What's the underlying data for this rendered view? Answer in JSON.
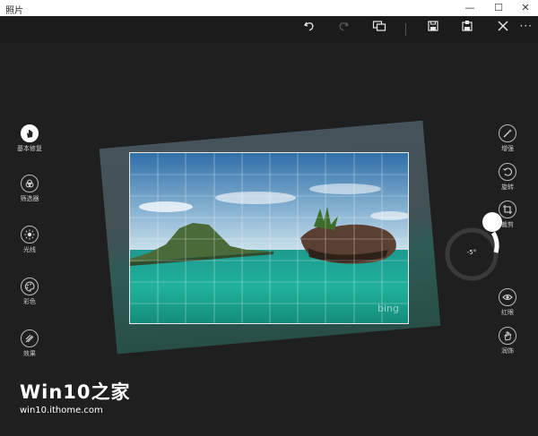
{
  "window": {
    "title": "照片",
    "minimize": "—",
    "maximize": "☐",
    "close": "✕"
  },
  "toolbar": {
    "undo_icon": "undo-icon",
    "redo_icon": "redo-icon",
    "compare_icon": "compare-icon",
    "save_icon": "save-icon",
    "save_copy_icon": "save-copy-icon",
    "cancel_icon": "close-icon",
    "more": "···"
  },
  "left_tools": [
    {
      "label": "基本修复",
      "icon": "hand-icon"
    },
    {
      "label": "筛选器",
      "icon": "filter-icon"
    },
    {
      "label": "光线",
      "icon": "sun-icon"
    },
    {
      "label": "彩色",
      "icon": "palette-icon"
    },
    {
      "label": "效果",
      "icon": "effects-icon"
    }
  ],
  "right_tools": [
    {
      "label": "增强",
      "icon": "wand-icon"
    },
    {
      "label": "旋转",
      "icon": "rotate-icon"
    },
    {
      "label": "裁剪",
      "icon": "crop-icon"
    },
    {
      "label": "红眼",
      "icon": "eye-icon"
    },
    {
      "label": "润饰",
      "icon": "hand-icon"
    }
  ],
  "photo": {
    "watermark": "bing"
  },
  "rotation": {
    "value_label": "-5°",
    "angle": -5
  },
  "watermark": {
    "main": "Win10之家",
    "sub": "win10.ithome.com"
  },
  "colors": {
    "background": "#1f1f1f",
    "toolbar": "#1b1b1b",
    "accent": "#ffffff"
  }
}
